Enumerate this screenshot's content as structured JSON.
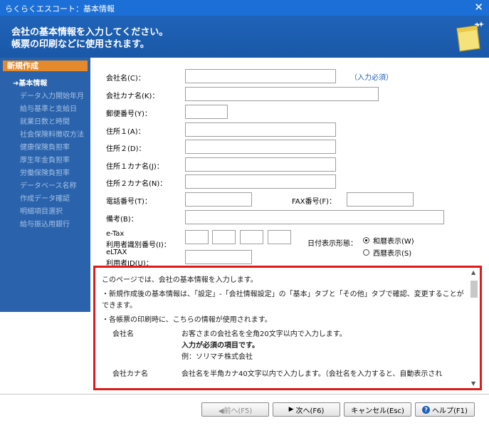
{
  "window": {
    "title": "らくらくエスコート：基本情報"
  },
  "banner": {
    "line1": "会社の基本情報を入力してください。",
    "line2": "帳票の印刷などに使用されます。"
  },
  "sidebar": {
    "section": "新規作成",
    "items": [
      {
        "label": "基本情報",
        "active": true
      },
      {
        "label": "データ入力開始年月"
      },
      {
        "label": "給与基準と支給日"
      },
      {
        "label": "就業日数と時間"
      },
      {
        "label": "社会保険料徴収方法"
      },
      {
        "label": "健康保険負担率"
      },
      {
        "label": "厚生年金負担率"
      },
      {
        "label": "労働保険負担率"
      },
      {
        "label": "データベース名称"
      },
      {
        "label": "作成データ確認"
      },
      {
        "label": "明細項目選択"
      },
      {
        "label": "給与振込用銀行"
      }
    ]
  },
  "form": {
    "company_name": {
      "label": "会社名(C)：",
      "value": ""
    },
    "required": "（入力必須）",
    "company_kana": {
      "label": "会社カナ名(K)：",
      "value": ""
    },
    "postal": {
      "label": "郵便番号(Y)：",
      "value": ""
    },
    "address1": {
      "label": "住所１(A)：",
      "value": ""
    },
    "address2": {
      "label": "住所２(D)：",
      "value": ""
    },
    "address1_kana": {
      "label": "住所１カナ名(J)：",
      "value": ""
    },
    "address2_kana": {
      "label": "住所２カナ名(N)：",
      "value": ""
    },
    "phone": {
      "label": "電話番号(T)：",
      "value": ""
    },
    "fax": {
      "label": "FAX番号(F)：",
      "value": ""
    },
    "memo": {
      "label": "備考(B)：",
      "value": ""
    },
    "etax": {
      "label1": "e-Tax",
      "label2": "利用者識別番号(I)：",
      "values": [
        "",
        "",
        "",
        ""
      ]
    },
    "eltax": {
      "label1": "eLTAX",
      "label2": "利用者ID(U)：",
      "value": ""
    },
    "date_format": {
      "label": "日付表示形態：",
      "options": [
        {
          "label": "和暦表示(W)",
          "selected": true
        },
        {
          "label": "西暦表示(S)",
          "selected": false
        }
      ]
    }
  },
  "help": {
    "intro": "このページでは、会社の基本情報を入力します。",
    "bullet1": "・新規作成後の基本情報は、「設定」-「会社情報設定」の「基本」タブと「その他」タブで確認、変更することができます。",
    "bullet2": "・各帳票の印刷時に、こちらの情報が使用されます。",
    "rows": [
      {
        "key": "会社名",
        "line1": "お客さまの会社名を全角20文字以内で入力します。",
        "line2": "入力が必須の項目です。",
        "line3": "例：ソリマチ株式会社"
      },
      {
        "key": "会社カナ名",
        "line1": "会社名を半角カナ40文字以内で入力します。（会社名を入力すると、自動表示され"
      }
    ]
  },
  "buttons": {
    "prev": "◀前へ(F5)",
    "next": "次へ(F6)",
    "cancel": "キャンセル(Esc)",
    "help": "ヘルプ(F1)"
  }
}
